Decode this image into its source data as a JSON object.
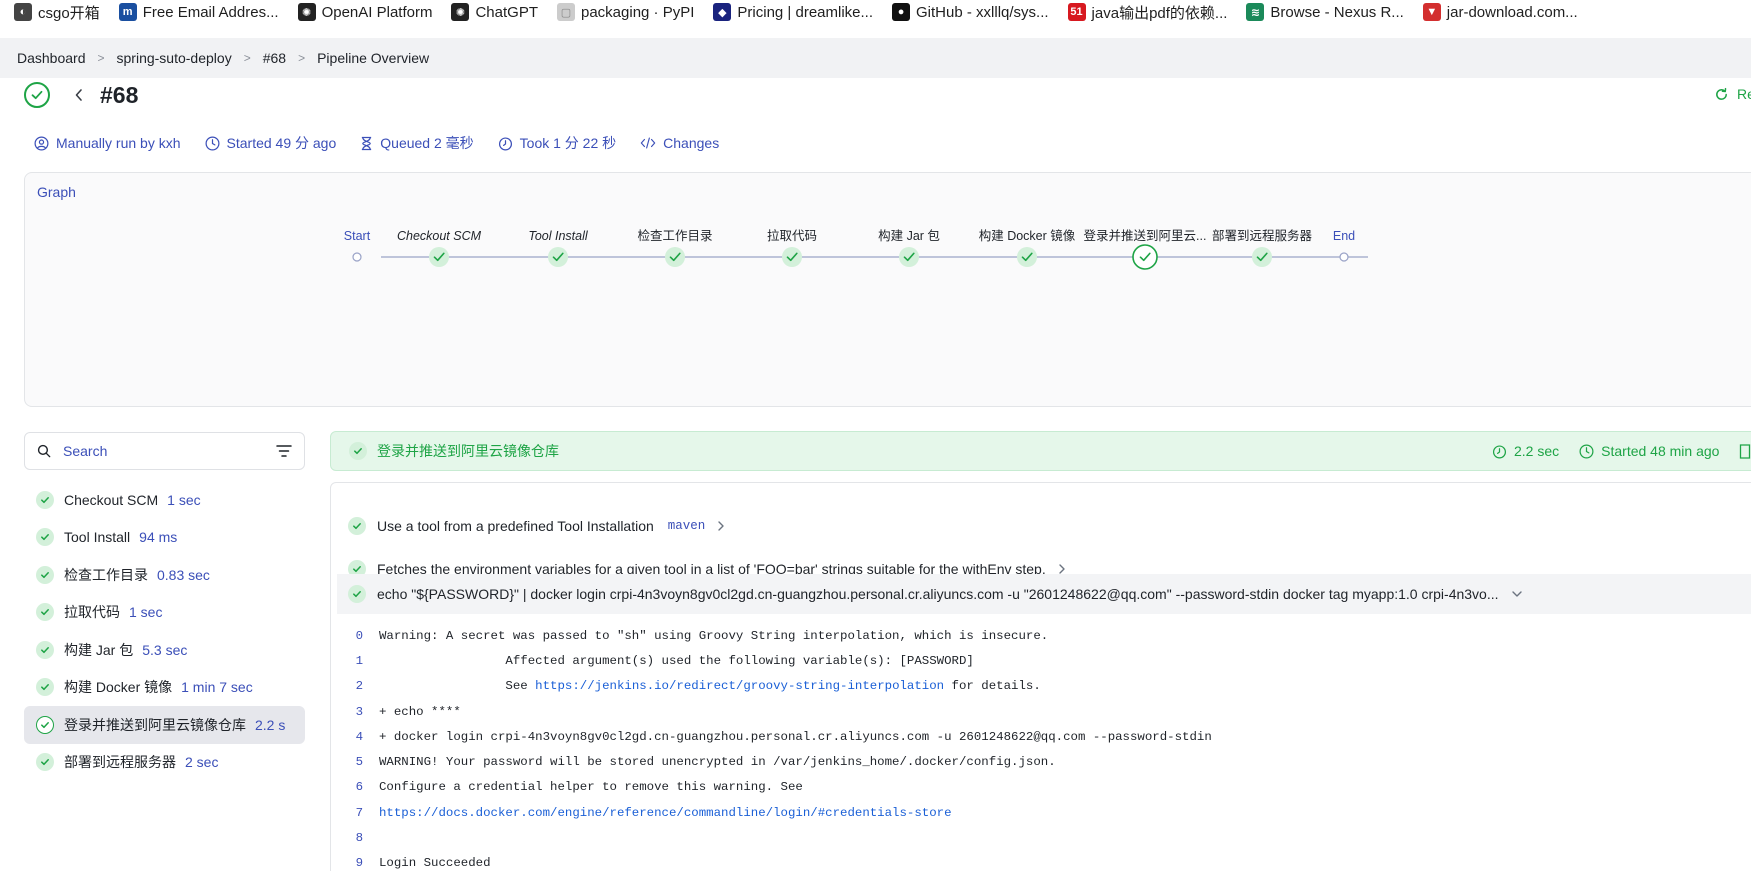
{
  "bookmarks": [
    {
      "label": "csgo开箱",
      "icon": "globe-icon",
      "color": "#444444"
    },
    {
      "label": "Free Email Addres...",
      "icon": "mailinator-icon",
      "color": "#1a4fa0"
    },
    {
      "label": "OpenAI Platform",
      "icon": "openai-icon",
      "color": "#222222"
    },
    {
      "label": "ChatGPT",
      "icon": "chatgpt-icon",
      "color": "#222222"
    },
    {
      "label": "packaging · PyPI",
      "icon": "pypi-icon",
      "color": "#cccccc"
    },
    {
      "label": "Pricing | dreamlike...",
      "icon": "dreamlike-icon",
      "color": "#1a237e"
    },
    {
      "label": "GitHub - xxlllq/sys...",
      "icon": "github-icon",
      "color": "#111111"
    },
    {
      "label": "java输出pdf的依赖...",
      "icon": "51cto-icon",
      "color": "#d71920"
    },
    {
      "label": "Browse - Nexus R...",
      "icon": "nexus-icon",
      "color": "#1b8a5a"
    },
    {
      "label": "jar-download.com...",
      "icon": "jar-download-icon",
      "color": "#d32f2f"
    }
  ],
  "breadcrumb": [
    "Dashboard",
    "spring-suto-deploy",
    "#68",
    "Pipeline Overview"
  ],
  "run": {
    "title": "#68",
    "rerun_label": "Re",
    "meta": {
      "trigger": "Manually run by kxh",
      "started": "Started 49 分 ago",
      "queued": "Queued 2 毫秒",
      "took": "Took 1 分 22 秒",
      "changes": "Changes"
    }
  },
  "graph": {
    "title": "Graph",
    "nodes": [
      {
        "label": "Start",
        "kind": "terminal"
      },
      {
        "label": "Checkout SCM",
        "kind": "stage",
        "italic": true
      },
      {
        "label": "Tool Install",
        "kind": "stage",
        "italic": true
      },
      {
        "label": "检查工作目录",
        "kind": "stage"
      },
      {
        "label": "拉取代码",
        "kind": "stage"
      },
      {
        "label": "构建 Jar 包",
        "kind": "stage"
      },
      {
        "label": "构建 Docker 镜像",
        "kind": "stage"
      },
      {
        "label": "登录并推送到阿里云...",
        "kind": "stage",
        "selected": true
      },
      {
        "label": "部署到远程服务器",
        "kind": "stage"
      },
      {
        "label": "End",
        "kind": "terminal"
      }
    ]
  },
  "search": {
    "placeholder": "Search"
  },
  "stages": [
    {
      "name": "Checkout SCM",
      "duration": "1 sec"
    },
    {
      "name": "Tool Install",
      "duration": "94 ms"
    },
    {
      "name": "检查工作目录",
      "duration": "0.83 sec"
    },
    {
      "name": "拉取代码",
      "duration": "1 sec"
    },
    {
      "name": "构建 Jar 包",
      "duration": "5.3 sec"
    },
    {
      "name": "构建 Docker 镜像",
      "duration": "1 min 7 sec"
    },
    {
      "name": "登录并推送到阿里云镜像仓库",
      "duration": "2.2 s",
      "active": true
    },
    {
      "name": "部署到远程服务器",
      "duration": "2 sec"
    }
  ],
  "selected_stage": {
    "title": "登录并推送到阿里云镜像仓库",
    "duration": "2.2 sec",
    "started": "Started 48 min ago"
  },
  "steps": [
    {
      "text": "Use a tool from a predefined Tool Installation",
      "tag": "maven"
    },
    {
      "text": "Fetches the environment variables for a given tool in a list of 'FOO=bar' strings suitable for the withEnv step.",
      "tag": ""
    },
    {
      "text": "echo \"${PASSWORD}\" | docker login crpi-4n3voyn8gv0cl2gd.cn-guangzhou.personal.cr.aliyuncs.com -u \"2601248622@qq.com\" --password-stdin docker tag myapp:1.0 crpi-4n3vo...",
      "tag": ""
    }
  ],
  "log": [
    {
      "num": "0",
      "text": "Warning: A secret was passed to \"sh\" using Groovy String interpolation, which is insecure.",
      "link": "",
      "after": ""
    },
    {
      "num": "1",
      "text": "                 Affected argument(s) used the following variable(s): [PASSWORD]",
      "link": "",
      "after": ""
    },
    {
      "num": "2",
      "text": "                 See ",
      "link": "https://jenkins.io/redirect/groovy-string-interpolation",
      "after": " for details."
    },
    {
      "num": "3",
      "text": "+ echo ****",
      "link": "",
      "after": ""
    },
    {
      "num": "4",
      "text": "+ docker login crpi-4n3voyn8gv0cl2gd.cn-guangzhou.personal.cr.aliyuncs.com -u 2601248622@qq.com --password-stdin",
      "link": "",
      "after": ""
    },
    {
      "num": "5",
      "text": "WARNING! Your password will be stored unencrypted in /var/jenkins_home/.docker/config.json.",
      "link": "",
      "after": ""
    },
    {
      "num": "6",
      "text": "Configure a credential helper to remove this warning. See",
      "link": "",
      "after": ""
    },
    {
      "num": "7",
      "text": "",
      "link": "https://docs.docker.com/engine/reference/commandline/login/#credentials-store",
      "after": ""
    },
    {
      "num": "8",
      "text": "",
      "link": "",
      "after": ""
    },
    {
      "num": "9",
      "text": "Login Succeeded",
      "link": "",
      "after": ""
    }
  ],
  "colors": {
    "success": "#1ea446",
    "link": "#3b4fb8",
    "success_bg": "#e5f7ea"
  }
}
